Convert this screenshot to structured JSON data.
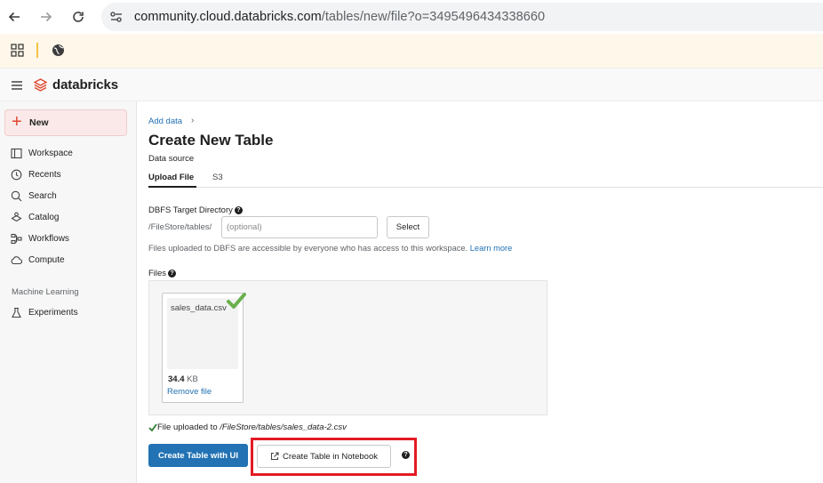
{
  "browser": {
    "url_host": "community.cloud.databricks.com",
    "url_path": "/tables/new/file?o=3495496434338660"
  },
  "app": {
    "brand": "databricks"
  },
  "sidebar": {
    "new_label": "New",
    "items": [
      {
        "label": "Workspace",
        "icon": "workspace-icon"
      },
      {
        "label": "Recents",
        "icon": "clock-icon"
      },
      {
        "label": "Search",
        "icon": "search-icon"
      },
      {
        "label": "Catalog",
        "icon": "catalog-icon"
      },
      {
        "label": "Workflows",
        "icon": "workflows-icon"
      },
      {
        "label": "Compute",
        "icon": "cloud-icon"
      }
    ],
    "section_heading": "Machine Learning",
    "ml_items": [
      {
        "label": "Experiments",
        "icon": "flask-icon"
      }
    ]
  },
  "main": {
    "breadcrumb": "Add data",
    "breadcrumb_sep": "›",
    "title": "Create New Table",
    "data_source_label": "Data source",
    "tabs": [
      {
        "label": "Upload File",
        "active": true
      },
      {
        "label": "S3",
        "active": false
      }
    ],
    "dbfs": {
      "label": "DBFS Target Directory",
      "prefix": "/FileStore/tables/",
      "placeholder": "(optional)",
      "value": "",
      "select_label": "Select",
      "info_text": "Files uploaded to DBFS are accessible by everyone who has access to this workspace.",
      "info_link": "Learn more"
    },
    "files": {
      "label": "Files",
      "file_name": "sales_data.csv",
      "file_size_value": "34.4",
      "file_size_unit": "KB",
      "remove_label": "Remove file"
    },
    "upload_status_prefix": "File uploaded to",
    "upload_status_path": "/FileStore/tables/sales_data-2.csv",
    "create_ui_label": "Create Table with UI",
    "create_notebook_label": "Create Table in Notebook"
  },
  "colors": {
    "primary": "#2272b4",
    "accent": "#e0452f",
    "success": "#6ab04c",
    "highlight": "#e31b23"
  }
}
